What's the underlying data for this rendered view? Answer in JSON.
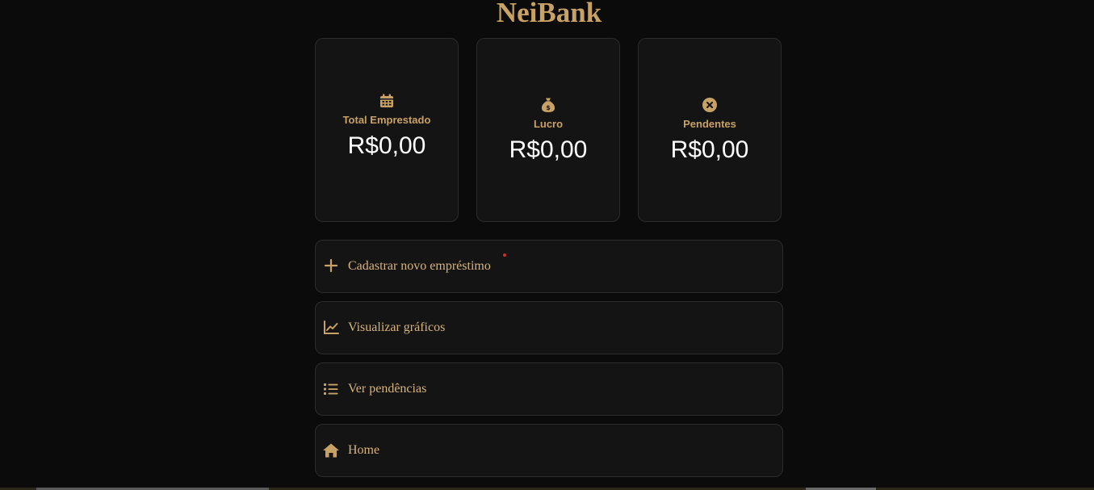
{
  "app": {
    "title": "NeiBank"
  },
  "summary_cards": [
    {
      "icon": "calendar-icon",
      "label": "Total Emprestado",
      "value": "R$0,00"
    },
    {
      "icon": "money-bag-icon",
      "label": "Lucro",
      "value": "R$0,00"
    },
    {
      "icon": "x-circle-icon",
      "label": "Pendentes",
      "value": "R$0,00"
    }
  ],
  "menu": [
    {
      "icon": "plus-icon",
      "label": "Cadastrar novo empréstimo"
    },
    {
      "icon": "line-chart-icon",
      "label": "Visualizar gráficos"
    },
    {
      "icon": "list-icon",
      "label": "Ver pendências"
    },
    {
      "icon": "home-icon",
      "label": "Home"
    }
  ],
  "colors": {
    "background": "#0b0b0b",
    "card_background": "#141414",
    "card_border": "#2c2c2c",
    "accent_gold": "#c8a165",
    "value_text": "#ffffff",
    "notification_dot": "#d02b2b"
  }
}
